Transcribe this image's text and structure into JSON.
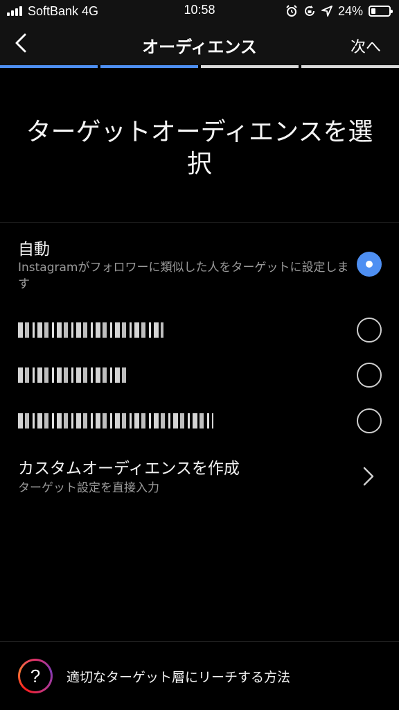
{
  "status_bar": {
    "carrier": "SoftBank 4G",
    "time": "10:58",
    "battery": "24%",
    "battery_level": 0.24,
    "icons": [
      "signal-icon",
      "alarm-icon",
      "rotation-lock-icon",
      "location-icon",
      "battery-icon"
    ]
  },
  "nav": {
    "title": "オーディエンス",
    "next_label": "次へ",
    "back_icon": "chevron-left-icon"
  },
  "progress": {
    "steps_total": 4,
    "steps_completed": 2,
    "active_color": "#4e8ff2",
    "inactive_color": "#d9d9d9"
  },
  "heading": "ターゲットオーディエンスを選択",
  "options": {
    "auto": {
      "title": "自動",
      "description": "Instagramがフォロワーに類似した人をターゲットに設定します",
      "selected": true
    },
    "custom": {
      "title": "カスタムオーディエンスを作成",
      "description": "ターゲット設定を直接入力"
    }
  },
  "help": {
    "label": "適切なターゲット層にリーチする方法",
    "icon": "question-icon"
  },
  "colors": {
    "accent": "#4e8ff2",
    "background": "#000000",
    "bar": "#121212"
  }
}
